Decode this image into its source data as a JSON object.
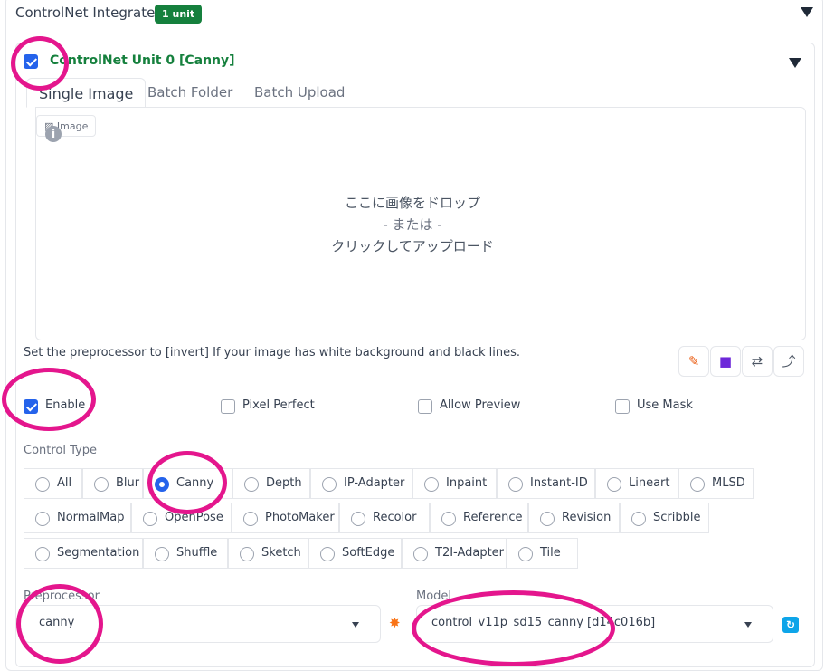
{
  "header": {
    "title": "ControlNet Integrated",
    "badge": "1 unit"
  },
  "unit": {
    "enabled": true,
    "title": "ControlNet Unit 0 [Canny]"
  },
  "tabs": [
    {
      "label": "Single Image",
      "active": true
    },
    {
      "label": "Batch Folder",
      "active": false
    },
    {
      "label": "Batch Upload",
      "active": false
    }
  ],
  "image_input": {
    "chip_label": "Image",
    "drop_line1": "ここに画像をドロップ",
    "drop_line2": "- または -",
    "drop_line3": "クリックしてアップロード"
  },
  "hint": "Set the preprocessor to [invert] If your image has white background and black lines.",
  "tool_icons": [
    "edit-icon",
    "camera-icon",
    "swap-icon",
    "arrow-icon"
  ],
  "options": [
    {
      "label": "Enable",
      "checked": true
    },
    {
      "label": "Pixel Perfect",
      "checked": false
    },
    {
      "label": "Allow Preview",
      "checked": false
    },
    {
      "label": "Use Mask",
      "checked": false
    }
  ],
  "control_type": {
    "label": "Control Type",
    "selected": "Canny",
    "rows": [
      [
        "All",
        "Blur",
        "Canny",
        "Depth",
        "IP-Adapter",
        "Inpaint",
        "Instant-ID",
        "Lineart",
        "MLSD"
      ],
      [
        "NormalMap",
        "OpenPose",
        "PhotoMaker",
        "Recolor",
        "Reference",
        "Revision",
        "Scribble"
      ],
      [
        "Segmentation",
        "Shuffle",
        "Sketch",
        "SoftEdge",
        "T2I-Adapter",
        "Tile"
      ]
    ]
  },
  "preprocessor": {
    "label": "Preprocessor",
    "value": "canny"
  },
  "model": {
    "label": "Model",
    "value": "control_v11p_sd15_canny [d14c016b]"
  },
  "colors": {
    "accent": "#2563eb",
    "unit_title": "#15803d",
    "annotation": "#e4168d"
  }
}
